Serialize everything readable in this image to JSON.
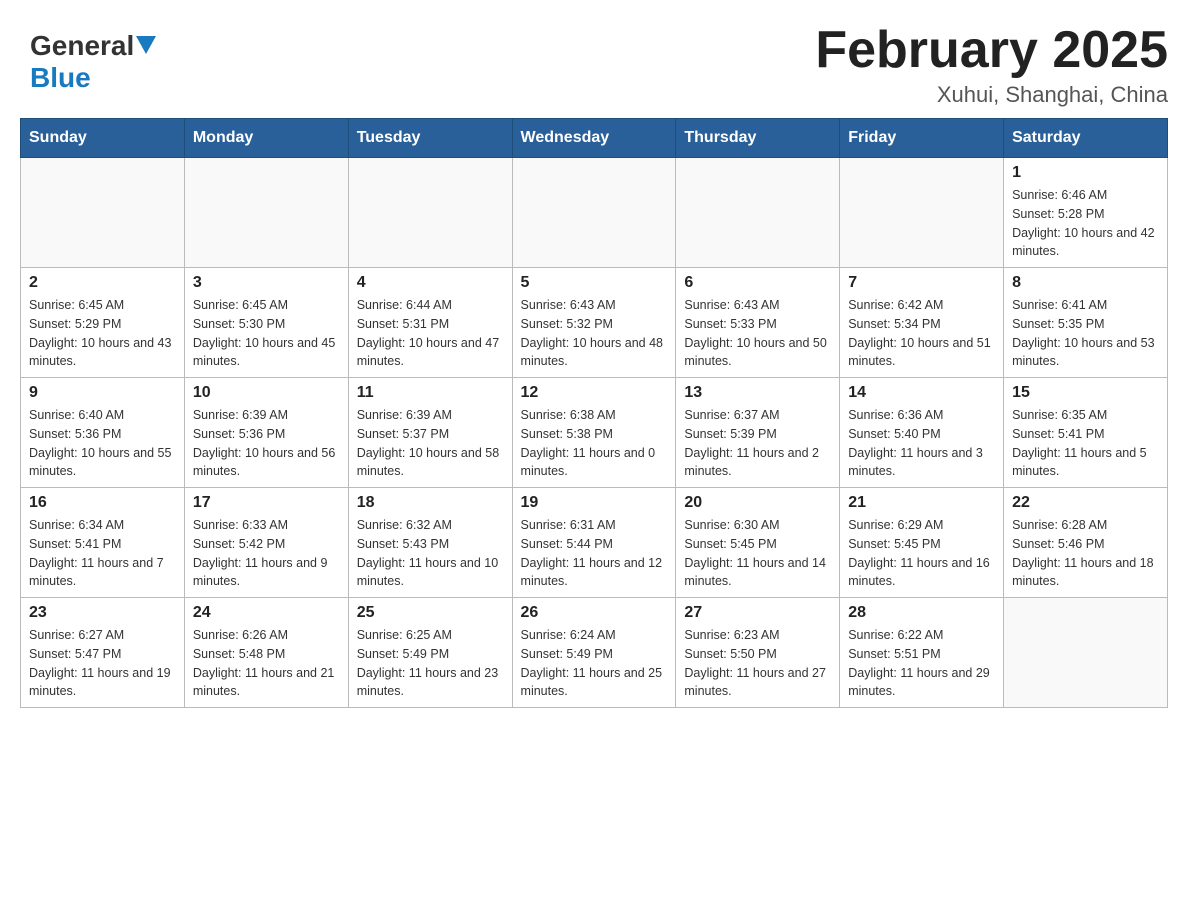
{
  "header": {
    "logo_general": "General",
    "logo_blue": "Blue",
    "title": "February 2025",
    "subtitle": "Xuhui, Shanghai, China"
  },
  "days_of_week": [
    "Sunday",
    "Monday",
    "Tuesday",
    "Wednesday",
    "Thursday",
    "Friday",
    "Saturday"
  ],
  "weeks": [
    [
      null,
      null,
      null,
      null,
      null,
      null,
      {
        "day": "1",
        "sunrise": "Sunrise: 6:46 AM",
        "sunset": "Sunset: 5:28 PM",
        "daylight": "Daylight: 10 hours and 42 minutes."
      }
    ],
    [
      {
        "day": "2",
        "sunrise": "Sunrise: 6:45 AM",
        "sunset": "Sunset: 5:29 PM",
        "daylight": "Daylight: 10 hours and 43 minutes."
      },
      {
        "day": "3",
        "sunrise": "Sunrise: 6:45 AM",
        "sunset": "Sunset: 5:30 PM",
        "daylight": "Daylight: 10 hours and 45 minutes."
      },
      {
        "day": "4",
        "sunrise": "Sunrise: 6:44 AM",
        "sunset": "Sunset: 5:31 PM",
        "daylight": "Daylight: 10 hours and 47 minutes."
      },
      {
        "day": "5",
        "sunrise": "Sunrise: 6:43 AM",
        "sunset": "Sunset: 5:32 PM",
        "daylight": "Daylight: 10 hours and 48 minutes."
      },
      {
        "day": "6",
        "sunrise": "Sunrise: 6:43 AM",
        "sunset": "Sunset: 5:33 PM",
        "daylight": "Daylight: 10 hours and 50 minutes."
      },
      {
        "day": "7",
        "sunrise": "Sunrise: 6:42 AM",
        "sunset": "Sunset: 5:34 PM",
        "daylight": "Daylight: 10 hours and 51 minutes."
      },
      {
        "day": "8",
        "sunrise": "Sunrise: 6:41 AM",
        "sunset": "Sunset: 5:35 PM",
        "daylight": "Daylight: 10 hours and 53 minutes."
      }
    ],
    [
      {
        "day": "9",
        "sunrise": "Sunrise: 6:40 AM",
        "sunset": "Sunset: 5:36 PM",
        "daylight": "Daylight: 10 hours and 55 minutes."
      },
      {
        "day": "10",
        "sunrise": "Sunrise: 6:39 AM",
        "sunset": "Sunset: 5:36 PM",
        "daylight": "Daylight: 10 hours and 56 minutes."
      },
      {
        "day": "11",
        "sunrise": "Sunrise: 6:39 AM",
        "sunset": "Sunset: 5:37 PM",
        "daylight": "Daylight: 10 hours and 58 minutes."
      },
      {
        "day": "12",
        "sunrise": "Sunrise: 6:38 AM",
        "sunset": "Sunset: 5:38 PM",
        "daylight": "Daylight: 11 hours and 0 minutes."
      },
      {
        "day": "13",
        "sunrise": "Sunrise: 6:37 AM",
        "sunset": "Sunset: 5:39 PM",
        "daylight": "Daylight: 11 hours and 2 minutes."
      },
      {
        "day": "14",
        "sunrise": "Sunrise: 6:36 AM",
        "sunset": "Sunset: 5:40 PM",
        "daylight": "Daylight: 11 hours and 3 minutes."
      },
      {
        "day": "15",
        "sunrise": "Sunrise: 6:35 AM",
        "sunset": "Sunset: 5:41 PM",
        "daylight": "Daylight: 11 hours and 5 minutes."
      }
    ],
    [
      {
        "day": "16",
        "sunrise": "Sunrise: 6:34 AM",
        "sunset": "Sunset: 5:41 PM",
        "daylight": "Daylight: 11 hours and 7 minutes."
      },
      {
        "day": "17",
        "sunrise": "Sunrise: 6:33 AM",
        "sunset": "Sunset: 5:42 PM",
        "daylight": "Daylight: 11 hours and 9 minutes."
      },
      {
        "day": "18",
        "sunrise": "Sunrise: 6:32 AM",
        "sunset": "Sunset: 5:43 PM",
        "daylight": "Daylight: 11 hours and 10 minutes."
      },
      {
        "day": "19",
        "sunrise": "Sunrise: 6:31 AM",
        "sunset": "Sunset: 5:44 PM",
        "daylight": "Daylight: 11 hours and 12 minutes."
      },
      {
        "day": "20",
        "sunrise": "Sunrise: 6:30 AM",
        "sunset": "Sunset: 5:45 PM",
        "daylight": "Daylight: 11 hours and 14 minutes."
      },
      {
        "day": "21",
        "sunrise": "Sunrise: 6:29 AM",
        "sunset": "Sunset: 5:45 PM",
        "daylight": "Daylight: 11 hours and 16 minutes."
      },
      {
        "day": "22",
        "sunrise": "Sunrise: 6:28 AM",
        "sunset": "Sunset: 5:46 PM",
        "daylight": "Daylight: 11 hours and 18 minutes."
      }
    ],
    [
      {
        "day": "23",
        "sunrise": "Sunrise: 6:27 AM",
        "sunset": "Sunset: 5:47 PM",
        "daylight": "Daylight: 11 hours and 19 minutes."
      },
      {
        "day": "24",
        "sunrise": "Sunrise: 6:26 AM",
        "sunset": "Sunset: 5:48 PM",
        "daylight": "Daylight: 11 hours and 21 minutes."
      },
      {
        "day": "25",
        "sunrise": "Sunrise: 6:25 AM",
        "sunset": "Sunset: 5:49 PM",
        "daylight": "Daylight: 11 hours and 23 minutes."
      },
      {
        "day": "26",
        "sunrise": "Sunrise: 6:24 AM",
        "sunset": "Sunset: 5:49 PM",
        "daylight": "Daylight: 11 hours and 25 minutes."
      },
      {
        "day": "27",
        "sunrise": "Sunrise: 6:23 AM",
        "sunset": "Sunset: 5:50 PM",
        "daylight": "Daylight: 11 hours and 27 minutes."
      },
      {
        "day": "28",
        "sunrise": "Sunrise: 6:22 AM",
        "sunset": "Sunset: 5:51 PM",
        "daylight": "Daylight: 11 hours and 29 minutes."
      },
      null
    ]
  ]
}
